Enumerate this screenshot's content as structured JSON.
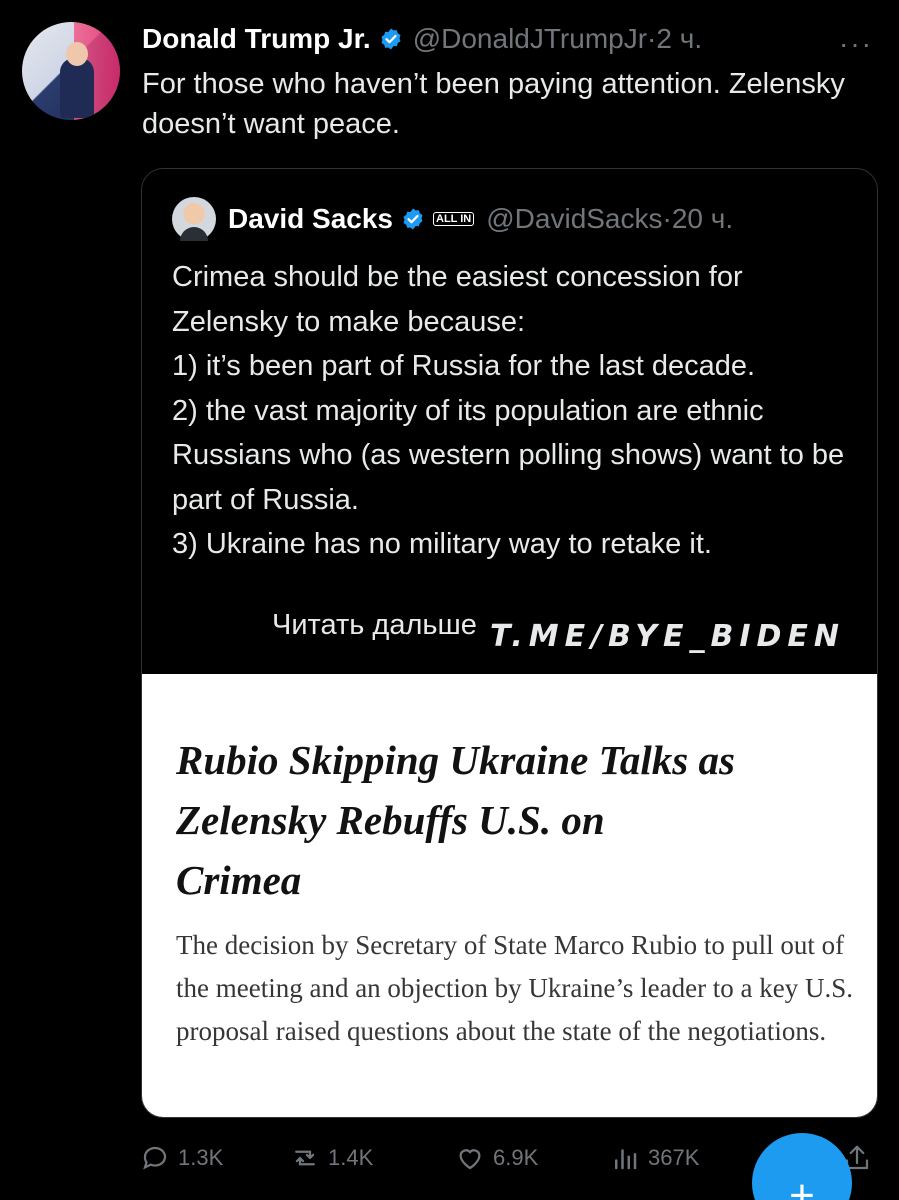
{
  "post": {
    "author_name": "Donald Trump Jr.",
    "handle": "@DonaldJTrumpJr",
    "separator": "·",
    "time": "2 ч.",
    "more_glyph": "···",
    "text": "For those who haven’t been paying attention. Zelensky doesn’t want peace."
  },
  "quote": {
    "author_name": "David Sacks",
    "badge_text": "ALL IN",
    "handle": "@DavidSacks",
    "separator": "·",
    "time": "20 ч.",
    "body": "Crimea should be the easiest concession for Zelensky to make because:\n1) it’s been part of Russia for the last decade.\n2) the vast majority of its population are ethnic Russians who (as western polling shows) want to be part of Russia.\n3) Ukraine has no military way to retake it.",
    "read_more": "Читать дальше",
    "watermark": "T.ME/BYE_BIDEN"
  },
  "article": {
    "headline": "Rubio Skipping Ukraine Talks as Zelensky Rebuffs U.S. on Crimea",
    "summary": "The decision by Secretary of State Marco Rubio to pull out of the meeting and an objection by Ukraine’s leader to a key U.S. proposal raised questions about the state of the negotiations."
  },
  "actions": {
    "replies": "1.3K",
    "reposts": "1.4K",
    "likes": "6.9K",
    "views": "367K",
    "compose_glyph": "+"
  },
  "colors": {
    "background": "#000000",
    "verified": "#1d9bf0",
    "muted": "#71767b",
    "accent": "#1d9bf0"
  },
  "icons": [
    "verified-icon",
    "more-icon",
    "reply-icon",
    "repost-icon",
    "like-icon",
    "views-icon",
    "bookmark-icon",
    "share-icon",
    "compose-icon"
  ]
}
